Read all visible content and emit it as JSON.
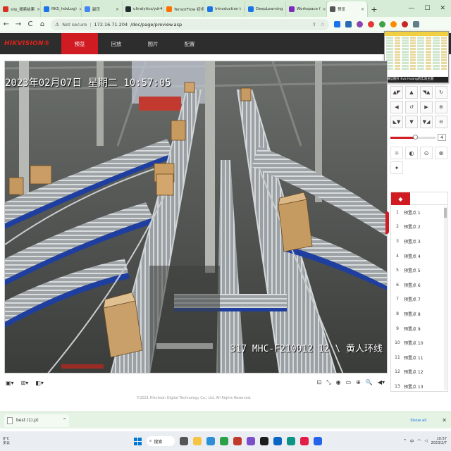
{
  "browser": {
    "tabs": [
      {
        "label": "sllp_搜索结果",
        "color": "#d93025"
      },
      {
        "label": "RKS_hdvLog)",
        "color": "#1a73e8"
      },
      {
        "label": "副页",
        "color": "#4285f4"
      },
      {
        "label": "ultralytics/ydr4",
        "color": "#24292e"
      },
      {
        "label": "TensorFlow 初步",
        "color": "#ff6f00"
      },
      {
        "label": "Introduction t",
        "color": "#1a73e8"
      },
      {
        "label": "DeepLearning",
        "color": "#1a73e8"
      },
      {
        "label": "Workspace f",
        "color": "#7b2cbf"
      },
      {
        "label": "预览",
        "color": "#555555",
        "active": true
      }
    ],
    "new_tab": "+",
    "window_controls": {
      "minimize": "—",
      "maximize": "☐",
      "close": "✕"
    },
    "nav": {
      "back": "←",
      "forward": "→",
      "reload": "C",
      "home": "⌂"
    },
    "address": {
      "security_label": "Not secure",
      "host": "172.16.71.204",
      "path": "/doc/page/preview.asp"
    }
  },
  "app": {
    "logo": "HIKVISION®",
    "menu": [
      {
        "label": "预览",
        "active": true
      },
      {
        "label": "回放"
      },
      {
        "label": "图片"
      },
      {
        "label": "配置"
      }
    ],
    "user_icon": "user-icon"
  },
  "thumbnail": {
    "caption": "微信图片 Eva Huang的实验主题"
  },
  "video": {
    "timestamp": "2023年02月07日 星期二 10:57:05",
    "camera_label": "317 MHC-F210012 12 \\ 黄人环线"
  },
  "ptz": {
    "buttons": [
      "▲◤",
      "▲",
      "◥▲",
      "↻",
      "◀",
      "↺",
      "▶",
      "⊕",
      "◣▼",
      "▼",
      "▼◢",
      "⊖"
    ],
    "speed_value": "4",
    "speed_fraction": 0.55,
    "tools": [
      "☼",
      "◐",
      "⊙",
      "⊗",
      "✦"
    ]
  },
  "presets": {
    "tabs": [
      "◆",
      "",
      ""
    ],
    "items": [
      {
        "num": "1",
        "name": "预置点 1"
      },
      {
        "num": "2",
        "name": "预置点 2"
      },
      {
        "num": "3",
        "name": "预置点 3"
      },
      {
        "num": "4",
        "name": "预置点 4"
      },
      {
        "num": "5",
        "name": "预置点 5"
      },
      {
        "num": "6",
        "name": "预置点 6"
      },
      {
        "num": "7",
        "name": "预置点 7"
      },
      {
        "num": "8",
        "name": "预置点 8"
      },
      {
        "num": "9",
        "name": "预置点 9"
      },
      {
        "num": "10",
        "name": "预置点 10"
      },
      {
        "num": "11",
        "name": "预置点 11"
      },
      {
        "num": "12",
        "name": "预置点 12"
      },
      {
        "num": "13",
        "name": "预置点 13"
      }
    ]
  },
  "bottom_toolbar": {
    "left": [
      "▣▾",
      "⊞▾",
      "◧▾"
    ],
    "right": [
      "⊡",
      "⤡",
      "◉",
      "▭",
      "⊕",
      "🔍",
      "◀▾"
    ]
  },
  "footer": "©2021 Hikvision Digital Technology Co., Ltd. All Rights Reserved.",
  "download": {
    "file": "best (1).pt",
    "caret": "^",
    "show_all": "Show all",
    "close": "✕"
  },
  "taskbar": {
    "weather_temp": "9°C",
    "weather_desc": "多云",
    "search_label": "搜索",
    "time": "10:57",
    "date": "2023/2/7",
    "ime": "中"
  }
}
